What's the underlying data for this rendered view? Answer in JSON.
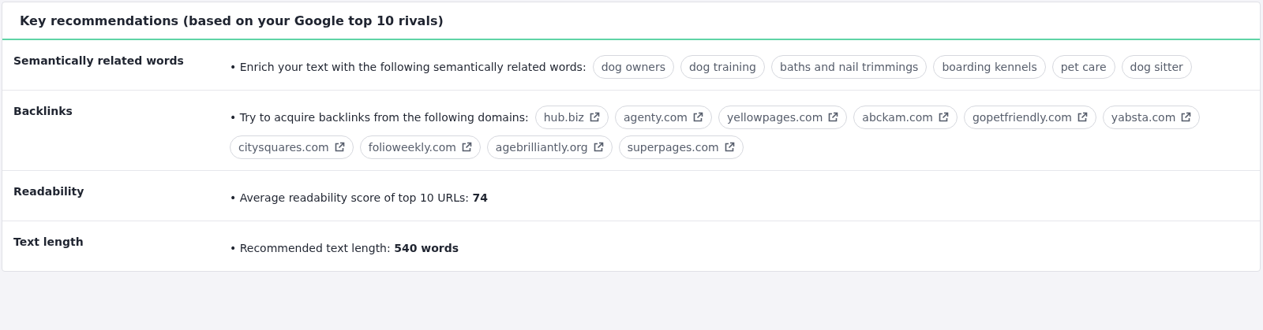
{
  "title": "Key recommendations (based on your Google top 10 rivals)",
  "rows": [
    {
      "label": "Semantically related words",
      "text": "• Enrich your text with the following semantically related words:",
      "tags": [
        {
          "kind": "word",
          "text": "dog owners"
        },
        {
          "kind": "word",
          "text": "dog training"
        },
        {
          "kind": "word",
          "text": "baths and nail trimmings"
        },
        {
          "kind": "word",
          "text": "boarding kennels"
        },
        {
          "kind": "word",
          "text": "pet care"
        },
        {
          "kind": "word",
          "text": "dog sitter"
        }
      ]
    },
    {
      "label": "Backlinks",
      "text": "• Try to acquire backlinks from the following domains:",
      "tags": [
        {
          "kind": "domain",
          "text": "hub.biz"
        },
        {
          "kind": "domain",
          "text": "agenty.com"
        },
        {
          "kind": "domain",
          "text": "yellowpages.com"
        },
        {
          "kind": "domain",
          "text": "abckam.com"
        },
        {
          "kind": "domain",
          "text": "gopetfriendly.com"
        },
        {
          "kind": "domain",
          "text": "yabsta.com"
        },
        {
          "kind": "domain",
          "text": "citysquares.com"
        },
        {
          "kind": "domain",
          "text": "folioweekly.com"
        },
        {
          "kind": "domain",
          "text": "agebrilliantly.org"
        },
        {
          "kind": "domain",
          "text": "superpages.com"
        }
      ]
    },
    {
      "label": "Readability",
      "text": "• Average readability score of top 10 URLs: **74**"
    },
    {
      "label": "Text length",
      "text": "• Recommended text length: **540 words**"
    }
  ]
}
